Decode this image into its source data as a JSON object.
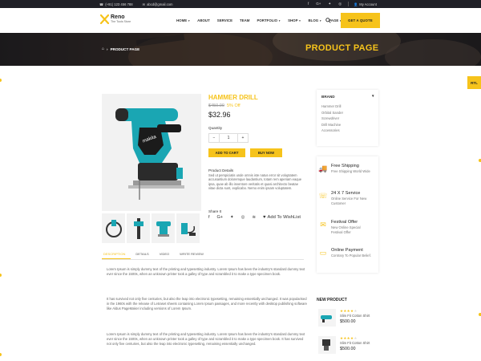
{
  "topbar": {
    "phone": "(+91) 123 456 788",
    "email": "abcd@gmail.com",
    "social_icons": [
      "facebook-icon",
      "google-plus-icon",
      "twitter-icon",
      "instagram-icon"
    ],
    "account_label": "My Account"
  },
  "header": {
    "brand_name": "Reno",
    "brand_tagline": "The Tools Store",
    "nav": [
      "HOME",
      "ABOUT",
      "SERVICE",
      "TEAM",
      "PORTFOLIO",
      "SHOP",
      "BLOG",
      "PAGE"
    ],
    "cta_label": "GET A QUOTE"
  },
  "banner": {
    "breadcrumb": "PRODUCT PAGE",
    "title": "PRODUCT PAGE"
  },
  "rtl_label": "RTL",
  "product": {
    "title": "HAMMER DRILL",
    "old_price": "$450.00",
    "discount": "5% Off",
    "price": "$32.96",
    "quantity_label": "Quantity",
    "quantity_value": "1",
    "add_to_cart_label": "ADD TO CART",
    "buy_now_label": "BUY NOW",
    "details_label": "Product Details",
    "details_text": "Sed ut perspiciatis unde omnis iste natus error sit voluptatem accusantium doloremque laudantium, totam rem aperiam eaque ipsa, quae ab illo inventore veritatis et quasi architecto beatae vitae dicta sunt, explicabo. Nemo enim ipsam voluptatem.",
    "share_label": "Share It",
    "wishlist_label": "Add To WishList"
  },
  "tabs": [
    "DESCRIPTION",
    "DETAILS",
    "VIDEO",
    "WRITE REVIEW"
  ],
  "description": [
    "Lorem Ipsum is simply dummy text of the printing and typesetting industry. Lorem Ipsum has been the industry's standard dummy text ever since the 1500s, when an unknown printer took a galley of type and scrambled it to make a type specimen book.",
    "It has survived not only five centuries, but also the leap into electronic typesetting, remaining essentially unchanged. It was popularised in the 1960s with the release of Letraset sheets containing Lorem Ipsum passages, and more recently with desktop publishing software like Aldus PageMaker including versions of Lorem Ipsum.",
    "Lorem Ipsum is simply dummy text of the printing and typesetting industry. Lorem Ipsum has been the industry's standard dummy text ever since the 1500s, when an unknown printer took a galley of type and scrambled it to make a type specimen book. It has survived not only five centuries, but also the leap into electronic typesetting, remaining essentially unchanged."
  ],
  "sidebar": {
    "brand_heading": "BRAND",
    "brands": [
      "Hammer Drill",
      "Orbital Sander",
      "Screwdriver",
      "Drill Machine",
      "Accessories"
    ],
    "features": [
      {
        "title": "Free Shipping",
        "subtitle": "Free Shipping World Wide",
        "icon": "truck-icon"
      },
      {
        "title": "24 X 7 Service",
        "subtitle": "Online Service For New Customer",
        "icon": "headset-icon"
      },
      {
        "title": "Festival Offer",
        "subtitle": "New Online Special Festival Offer",
        "icon": "gift-icon"
      },
      {
        "title": "Online Payment",
        "subtitle": "Contrary To Popular Belief.",
        "icon": "card-icon"
      }
    ],
    "new_product_heading": "NEW PRODUCT",
    "new_products": [
      {
        "name": "Slim Fit Cotton Shirt",
        "price": "$500.00",
        "rating": 4
      },
      {
        "name": "Slim Fit Cotton Shirt",
        "price": "$500.00",
        "rating": 4
      }
    ]
  },
  "colors": {
    "accent": "#f6c31b",
    "topbar": "#1f2027",
    "drill": "#1aa6b3"
  }
}
